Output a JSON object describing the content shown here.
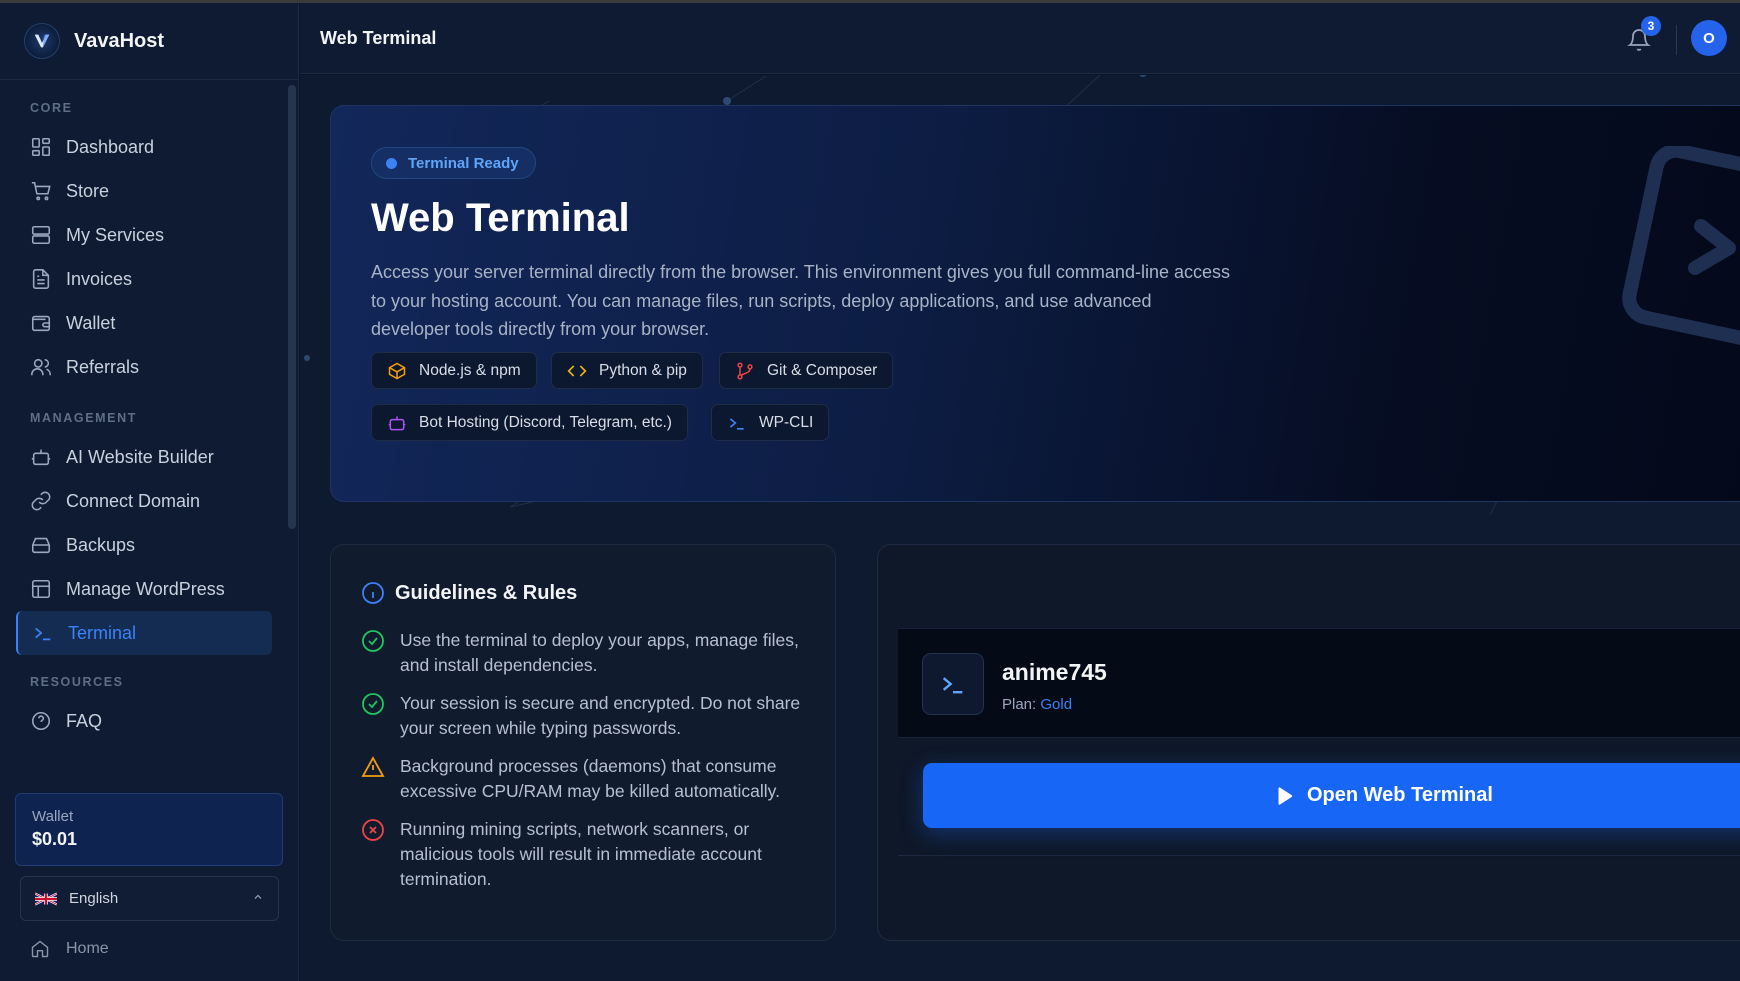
{
  "app": {
    "name": "VavaHost"
  },
  "sidebar": {
    "sections": [
      {
        "label": "CORE",
        "items": [
          {
            "label": "Dashboard",
            "icon": "dashboard-icon"
          },
          {
            "label": "Store",
            "icon": "cart-icon"
          },
          {
            "label": "My Services",
            "icon": "server-icon"
          },
          {
            "label": "Invoices",
            "icon": "invoice-icon"
          },
          {
            "label": "Wallet",
            "icon": "wallet-icon"
          },
          {
            "label": "Referrals",
            "icon": "users-icon"
          }
        ]
      },
      {
        "label": "MANAGEMENT",
        "items": [
          {
            "label": "AI Website Builder",
            "icon": "bot-icon"
          },
          {
            "label": "Connect Domain",
            "icon": "link-icon"
          },
          {
            "label": "Backups",
            "icon": "backup-icon"
          },
          {
            "label": "Manage WordPress",
            "icon": "layout-icon"
          },
          {
            "label": "Terminal",
            "icon": "terminal-icon",
            "active": true
          }
        ]
      },
      {
        "label": "RESOURCES",
        "items": [
          {
            "label": "FAQ",
            "icon": "help-icon"
          }
        ]
      }
    ],
    "wallet": {
      "label": "Wallet",
      "value": "$0.01"
    },
    "language": {
      "selected": "English"
    },
    "home": {
      "label": "Home"
    }
  },
  "header": {
    "title": "Web Terminal",
    "notification_count": "3",
    "avatar_initial": "O"
  },
  "hero": {
    "status": "Terminal Ready",
    "title": "Web Terminal",
    "description": "Access your server terminal directly from the browser. This environment gives you full command-line access to your hosting account. You can manage files, run scripts, deploy applications, and use advanced developer tools directly from your browser.",
    "tags": [
      {
        "label": "Node.js & npm",
        "icon": "package-icon",
        "color": "#f59e0b"
      },
      {
        "label": "Python & pip",
        "icon": "code-icon",
        "color": "#eab308"
      },
      {
        "label": "Git & Composer",
        "icon": "git-branch-icon",
        "color": "#ef4444"
      },
      {
        "label": "Bot Hosting (Discord, Telegram, etc.)",
        "icon": "bot-icon",
        "color": "#a855f7"
      },
      {
        "label": "WP-CLI",
        "icon": "terminal-icon",
        "color": "#3b82f6"
      }
    ]
  },
  "guidelines": {
    "title": "Guidelines & Rules",
    "rules": [
      {
        "text": "Use the terminal to deploy your apps, manage files, and install dependencies.",
        "type": "ok"
      },
      {
        "text": "Your session is secure and encrypted. Do not share your screen while typing passwords.",
        "type": "ok"
      },
      {
        "text": "Background processes (daemons) that consume excessive CPU/RAM may be killed automatically.",
        "type": "warn"
      },
      {
        "text": "Running mining scripts, network scanners, or malicious tools will result in immediate account termination.",
        "type": "error"
      }
    ]
  },
  "account": {
    "username": "anime745",
    "plan_label": "Plan:",
    "plan": "Gold"
  },
  "actions": {
    "open_terminal": "Open Web Terminal"
  },
  "colors": {
    "accent": "#3b82f6",
    "button": "#1766f5",
    "success": "#22c55e",
    "warning": "#f59e0b",
    "danger": "#ef4444"
  }
}
